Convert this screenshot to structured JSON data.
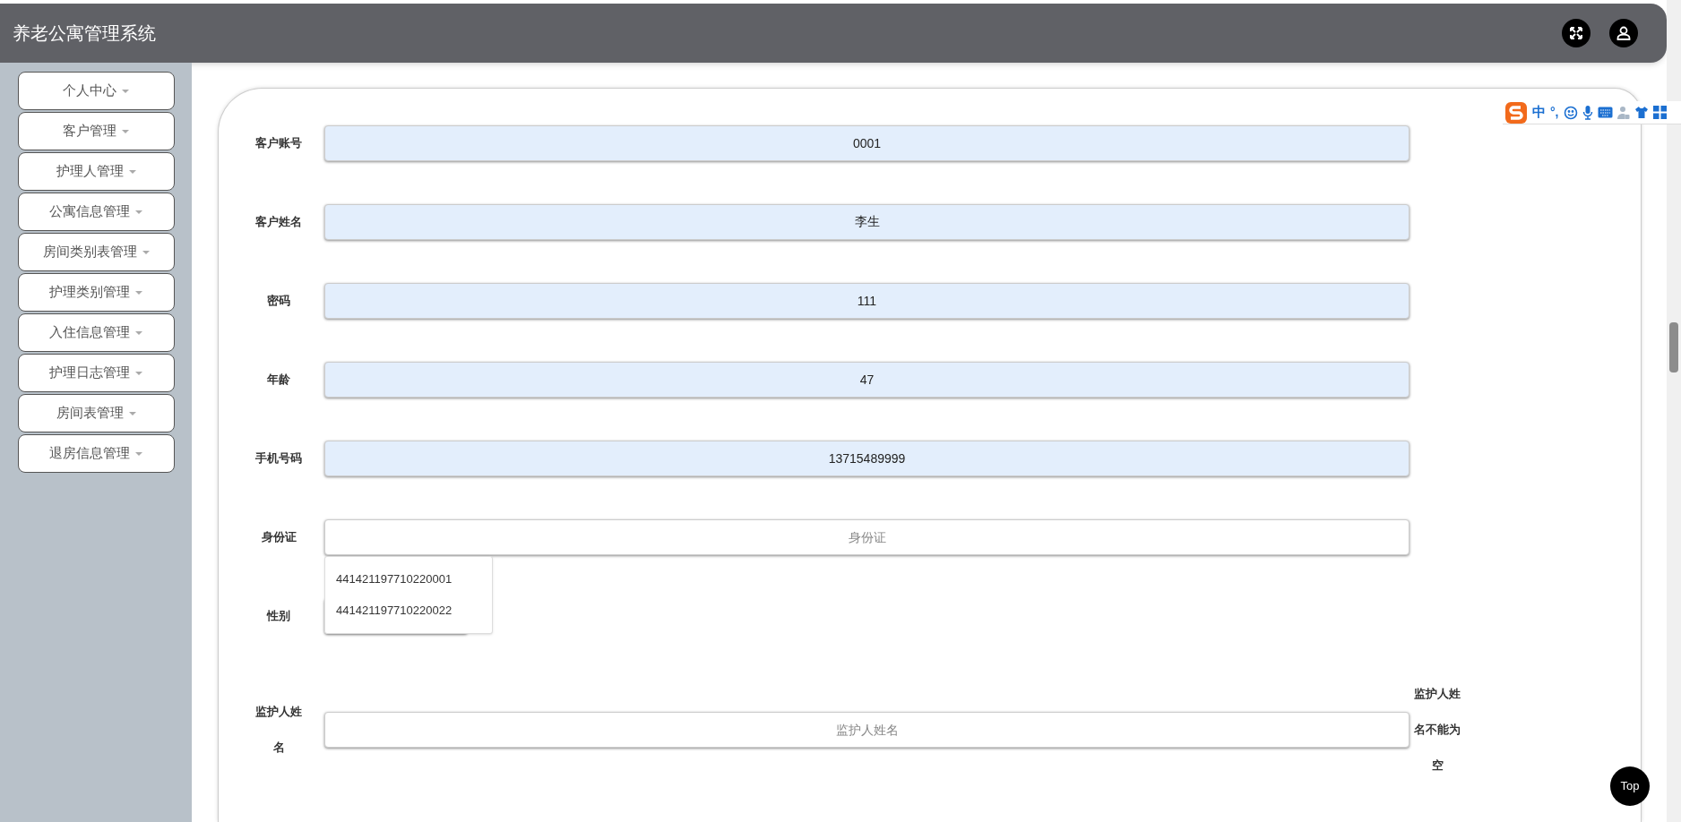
{
  "header": {
    "title": "养老公寓管理系统"
  },
  "sidebar": {
    "items": [
      {
        "label": "个人中心"
      },
      {
        "label": "客户管理"
      },
      {
        "label": "护理人管理"
      },
      {
        "label": "公寓信息管理"
      },
      {
        "label": "房间类别表管理"
      },
      {
        "label": "护理类别管理"
      },
      {
        "label": "入住信息管理"
      },
      {
        "label": "护理日志管理"
      },
      {
        "label": "房间表管理"
      },
      {
        "label": "退房信息管理"
      }
    ]
  },
  "ime_toolbar": {
    "language": "中",
    "punctuation": "°,"
  },
  "form": {
    "fields": [
      {
        "kind": "text",
        "label": "客户账号",
        "value": "0001"
      },
      {
        "kind": "text",
        "label": "客户姓名",
        "value": "李生"
      },
      {
        "kind": "text",
        "label": "密码",
        "value": "111"
      },
      {
        "kind": "text",
        "label": "年龄",
        "value": "47"
      },
      {
        "kind": "text",
        "label": "手机号码",
        "value": "13715489999"
      },
      {
        "kind": "text",
        "label": "身份证",
        "placeholder": "身份证",
        "suggestions": [
          "441421197710220001",
          "441421197710220022"
        ]
      },
      {
        "kind": "select",
        "label": "性别"
      },
      {
        "kind": "text",
        "label": "监护人姓名",
        "placeholder": "监护人姓名",
        "error": "监护人姓名不能为空"
      }
    ]
  },
  "back_to_top": {
    "label": "Top"
  }
}
